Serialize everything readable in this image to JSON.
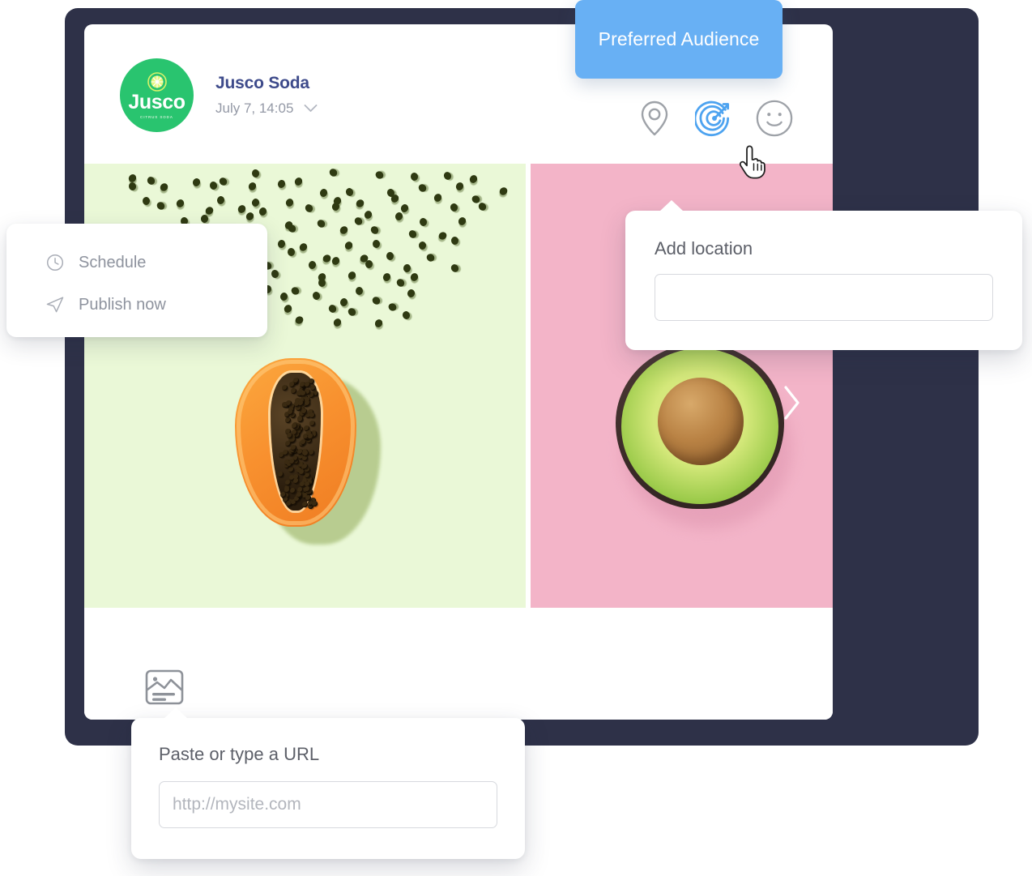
{
  "brand": {
    "avatar_logo_text": "Jusco",
    "avatar_logo_subtext": "CITRUS SODA",
    "avatar_icon": "citrus-slice-icon",
    "name": "Jusco Soda",
    "post_datetime": "July 7, 14:05",
    "datetime_chevron_icon": "chevron-down-icon"
  },
  "header_actions": [
    {
      "icon": "location-pin-icon",
      "name": "add-location-button",
      "state": "inactive"
    },
    {
      "icon": "target-audience-icon",
      "name": "preferred-audience-button",
      "state": "active"
    },
    {
      "icon": "smiley-face-icon",
      "name": "emoji-button",
      "state": "inactive"
    }
  ],
  "tooltip": {
    "label": "Preferred Audience",
    "background": "#68b0f4",
    "text_color": "#ffffff"
  },
  "publish_menu": {
    "items": [
      {
        "label": "Schedule",
        "icon": "clock-icon",
        "name": "schedule-menu-item"
      },
      {
        "label": "Publish now",
        "icon": "send-paper-plane-icon",
        "name": "publish-now-menu-item"
      }
    ]
  },
  "location_popover": {
    "title": "Add location",
    "input_value": "",
    "input_placeholder": ""
  },
  "url_popover": {
    "title": "Paste or type a URL",
    "input_value": "",
    "input_placeholder": "http://mysite.com"
  },
  "media": {
    "attach_icon": "image-media-icon",
    "next_icon": "chevron-right-icon",
    "slides": [
      {
        "name": "papaya-slide",
        "subject": "papaya-half",
        "background": "#eaf8d7"
      },
      {
        "name": "avocado-slide",
        "subject": "avocado-half",
        "background": "#f3b4c8"
      }
    ]
  },
  "cursor": {
    "icon": "pointing-hand-cursor"
  },
  "colors": {
    "brand_green": "#29c46f",
    "brand_navy": "#3e4b8b",
    "accent_blue": "#4da3f0",
    "frame_navy": "#2e3148",
    "muted_text": "#9499a6"
  }
}
